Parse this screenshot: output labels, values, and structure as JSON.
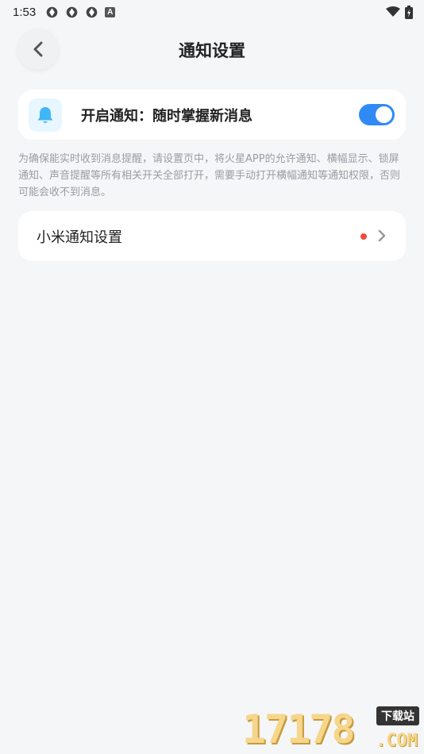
{
  "status_bar": {
    "time": "1:53",
    "icons": [
      "app-badge-icon",
      "app-badge-icon",
      "app-badge-icon",
      "a-icon",
      "wifi-icon",
      "battery-charging-icon"
    ],
    "a_label": "A"
  },
  "header": {
    "title": "通知设置",
    "back_icon": "chevron-left-icon"
  },
  "notify_card": {
    "label": "开启通知：随时掌握新消息",
    "icon": "bell-icon",
    "toggle_on": true,
    "accent": "#2f8af5"
  },
  "hint": {
    "text": "为确保能实时收到消息提醒，请设置页中，将火星APP的允许通知、横幅显示、锁屏通知、声音提醒等所有相关开关全部打开，需要手动打开横幅通知等通知权限，否则可能会收不到消息。"
  },
  "xiaomi_card": {
    "label": "小米通知设置",
    "badge_color": "#f04a3c"
  },
  "watermark": {
    "number": "17178",
    "tag": "下载站",
    "domain": ".COM"
  }
}
